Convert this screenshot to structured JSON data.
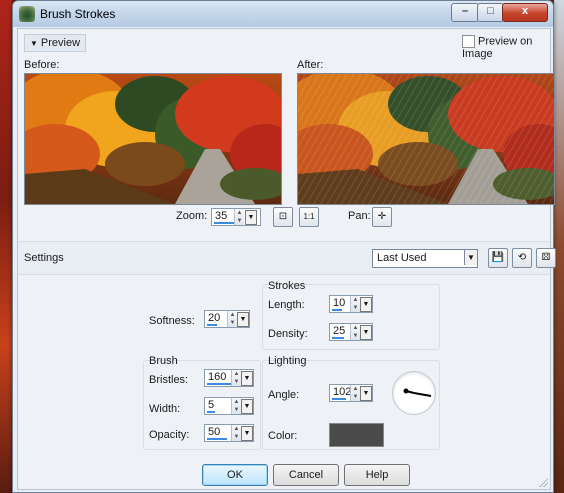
{
  "window": {
    "title": "Brush Strokes"
  },
  "window_controls": {
    "minimize": "–",
    "maximize": "□",
    "close": "x"
  },
  "preview": {
    "toggle_label": "Preview",
    "preview_on_image_label": "Preview on Image",
    "preview_on_image_checked": false,
    "before_label": "Before:",
    "after_label": "After:",
    "zoom_label": "Zoom:",
    "zoom_value": "35",
    "pan_label": "Pan:"
  },
  "settings": {
    "label": "Settings",
    "preset_value": "Last Used"
  },
  "strokes": {
    "group_title": "Strokes",
    "length_label": "Length:",
    "length_value": "10",
    "density_label": "Density:",
    "density_value": "25"
  },
  "softness": {
    "label": "Softness:",
    "value": "20"
  },
  "brush": {
    "group_title": "Brush",
    "bristles_label": "Bristles:",
    "bristles_value": "160",
    "width_label": "Width:",
    "width_value": "5",
    "opacity_label": "Opacity:",
    "opacity_value": "50"
  },
  "lighting": {
    "group_title": "Lighting",
    "angle_label": "Angle:",
    "angle_value": "102",
    "color_label": "Color:",
    "color_hex": "#4b4b4b"
  },
  "buttons": {
    "ok": "OK",
    "cancel": "Cancel",
    "help": "Help"
  },
  "icons": {
    "app": "brush-strokes-app-icon",
    "zoom_fit": "zoom-fit-icon",
    "zoom_actual": "zoom-actual-size-icon",
    "pan": "pan-move-icon",
    "save_preset": "save-preset-icon",
    "reset": "reset-icon",
    "randomize": "randomize-icon"
  }
}
